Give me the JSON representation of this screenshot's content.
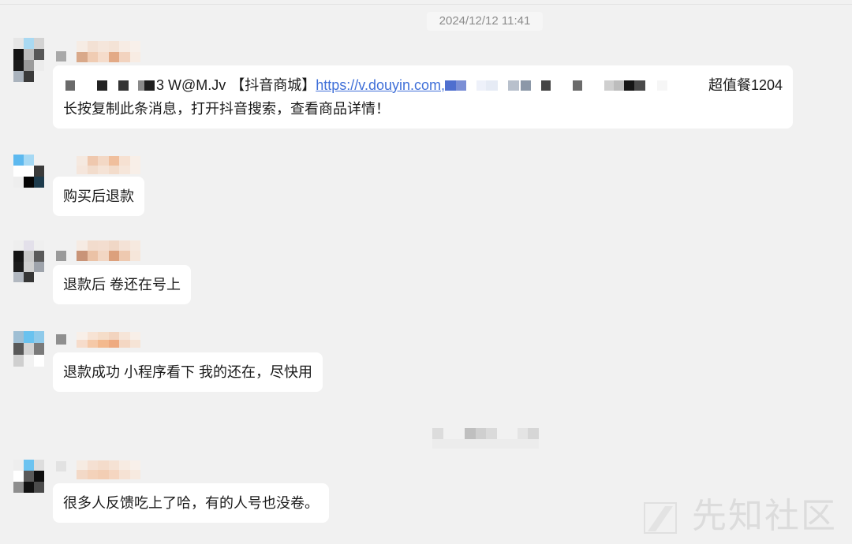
{
  "timestamp": "2024/12/12 11:41",
  "messages": [
    {
      "line1": {
        "code": "3 W@M.Jv",
        "platform": "【抖音商城】",
        "link": "https://v.douyin.com,",
        "suffix": "超值餐1204"
      },
      "line2": "长按复制此条消息，打开抖音搜索，查看商品详情！"
    },
    {
      "text": "购买后退款"
    },
    {
      "text": "退款后 卷还在号上"
    },
    {
      "text": "退款成功 小程序看下 我的还在，尽快用"
    },
    {
      "text": "很多人反馈吃上了哈，有的人号也没卷。"
    }
  ],
  "watermark": {
    "text": "先知社区",
    "icon": "xianzhi-logo-icon"
  },
  "colors": {
    "background": "#f1f1f1",
    "bubble": "#ffffff",
    "text": "#1a1a1a",
    "link": "#3f6fd8",
    "timestamp": "#8c8c8c",
    "watermark": "#dcdcdc"
  }
}
